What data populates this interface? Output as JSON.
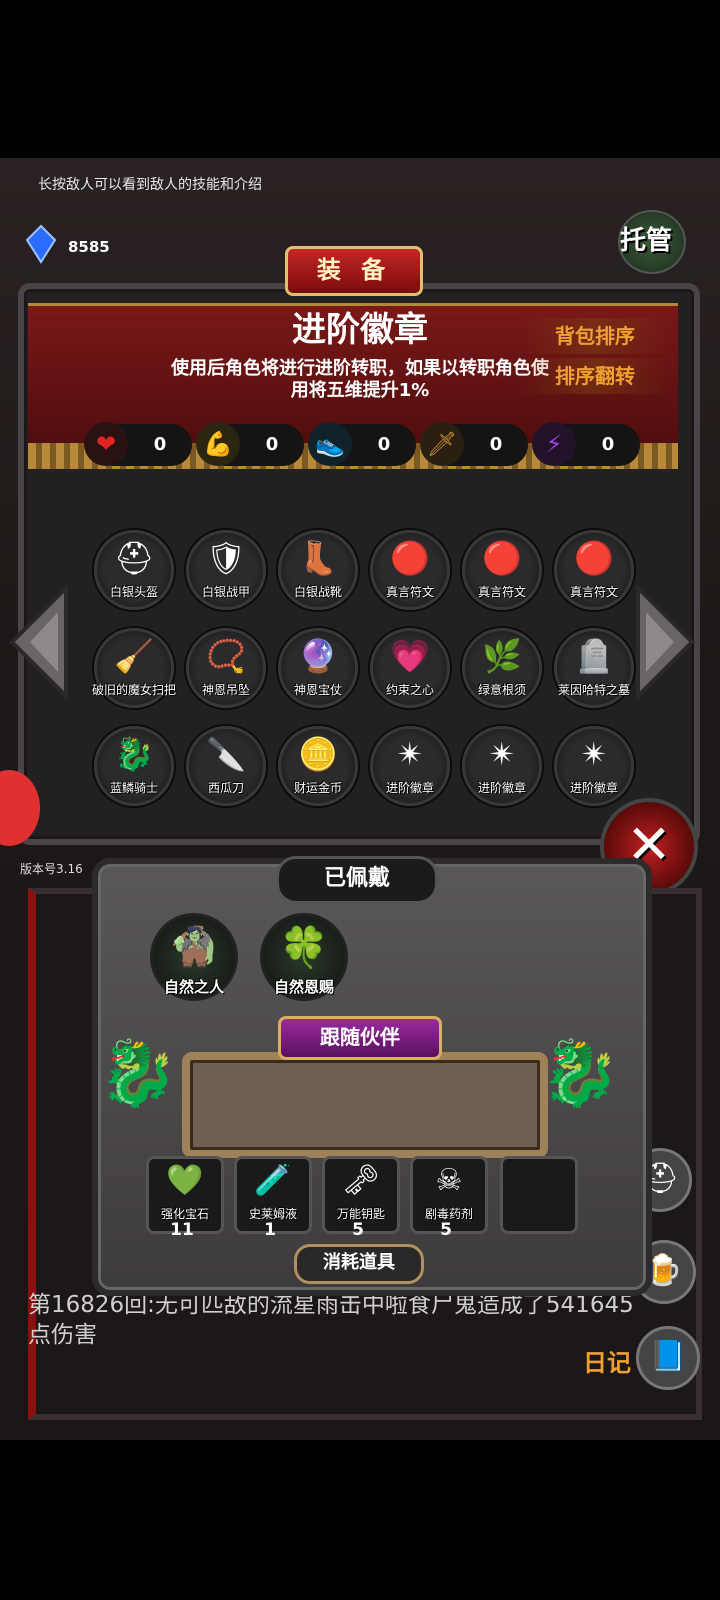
{
  "hud": {
    "hint": "长按敌人可以看到敌人的技能和介绍",
    "gem_count": "8585",
    "gem_label": "宝石",
    "auto_label": "托管",
    "version": "版本号3.16"
  },
  "equip": {
    "tab_label": "装 备",
    "item_title": "进阶徽章",
    "item_desc": "使用后角色将进行进阶转职，如果以转职角色使用将五维提升1%",
    "sort_label": "背包排序",
    "reverse_label": "排序翻转",
    "stats": [
      {
        "icon": "heart-icon",
        "value": "0"
      },
      {
        "icon": "strength-icon",
        "value": "0"
      },
      {
        "icon": "speed-icon",
        "value": "0"
      },
      {
        "icon": "sword-icon",
        "value": "0"
      },
      {
        "icon": "magic-icon",
        "value": "0"
      }
    ],
    "items": [
      {
        "name": "白银头盔",
        "icon": "⛑"
      },
      {
        "name": "白银战甲",
        "icon": "🛡"
      },
      {
        "name": "白银战靴",
        "icon": "👢"
      },
      {
        "name": "真言符文",
        "icon": "🔴"
      },
      {
        "name": "真言符文",
        "icon": "🔴"
      },
      {
        "name": "真言符文",
        "icon": "🔴"
      },
      {
        "name": "破旧的魔女扫把",
        "icon": "🧹"
      },
      {
        "name": "神恩吊坠",
        "icon": "📿"
      },
      {
        "name": "神恩宝仗",
        "icon": "🔮"
      },
      {
        "name": "约束之心",
        "icon": "💗"
      },
      {
        "name": "绿意根须",
        "icon": "🌿"
      },
      {
        "name": "莱因哈特之墓",
        "icon": "🪦"
      },
      {
        "name": "蓝鳞骑士",
        "icon": "🐉"
      },
      {
        "name": "西瓜刀",
        "icon": "🔪"
      },
      {
        "name": "财运金币",
        "icon": "🪙"
      },
      {
        "name": "进阶徽章",
        "icon": "✴"
      },
      {
        "name": "进阶徽章",
        "icon": "✴"
      },
      {
        "name": "进阶徽章",
        "icon": "✴"
      }
    ]
  },
  "worn": {
    "tab_label": "已佩戴",
    "items": [
      {
        "name": "自然之人",
        "icon": "🧌"
      },
      {
        "name": "自然恩赐",
        "icon": "🍀"
      }
    ],
    "follow_label": "跟随伙伴",
    "consumables_label": "消耗道具",
    "consumables": [
      {
        "name": "强化宝石",
        "icon": "💚",
        "count": "11"
      },
      {
        "name": "史莱姆液",
        "icon": "🧪",
        "count": "1"
      },
      {
        "name": "万能钥匙",
        "icon": "🗝",
        "count": "5"
      },
      {
        "name": "剧毒药剂",
        "icon": "☠",
        "count": "5"
      }
    ]
  },
  "log": {
    "line1": "第16826回:无可匹敌的流星雨击中啦食尸鬼造成了541645点伤害",
    "diary_label": "日记"
  }
}
